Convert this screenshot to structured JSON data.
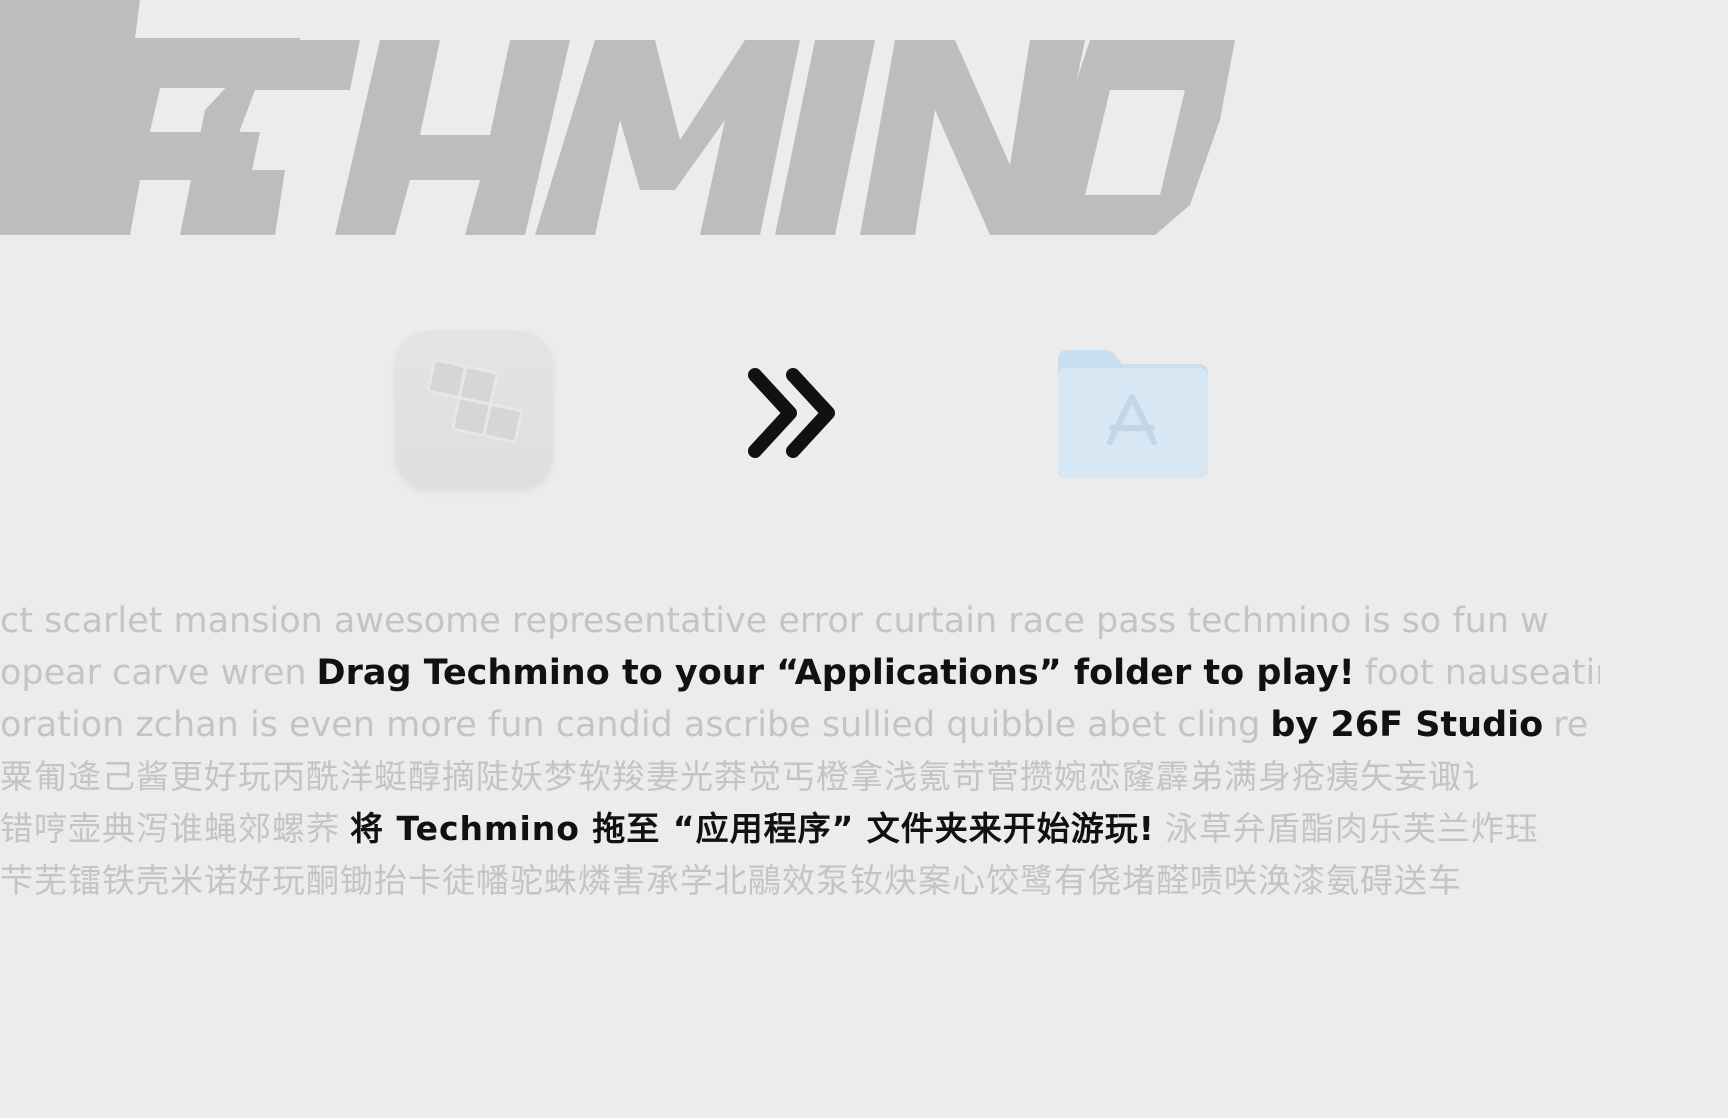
{
  "logo": {
    "text": "TECHMINO",
    "color": "#bdbdbd"
  },
  "icons": {
    "app": "techmino-app-icon",
    "arrow": "double-chevron-right-icon",
    "folder": "applications-folder-icon"
  },
  "lines": {
    "l1_filler": "ct scarlet mansion awesome representative error curtain race pass techmino is so fun w",
    "l2_filler_before": "opear carve wren",
    "l2_highlight": "Drag Techmino to your “Applications” folder to play!",
    "l2_filler_after": "foot nauseating c",
    "l3_filler_before": "oration zchan is even more fun candid ascribe sullied quibble abet cling",
    "l3_highlight": "by 26F Studio",
    "l3_filler_after": "re",
    "l4_filler": "粟匍逄己酱更好玩丙酰洋蜓醇摘陡妖梦软羧妻光莽觉丐橙拿浅氪苛菅攒婉恋窿霹弟满身疮痍矢妄诹讠",
    "l5_filler_before": "错哼壶典泻谁蝇郊螺荞",
    "l5_highlight": "将 Techmino 拖至 “应用程序” 文件夹来开始游玩!",
    "l5_filler_after": "泳草弁盾酯肉乐芙兰炸珏",
    "l6_filler": "芐芜镭铁壳米诺好玩酮锄抬卡徒幡驼蛛燐害承学北鷊效泵钕炔案心饺鹭有侥堵醛啧咲涣漆氨碍送车"
  },
  "colors": {
    "background": "#ececec",
    "filler_text": "#c4c4c4",
    "highlight_text": "#111111",
    "folder_light": "#d3e6f3",
    "folder_tab": "#c5dced"
  }
}
